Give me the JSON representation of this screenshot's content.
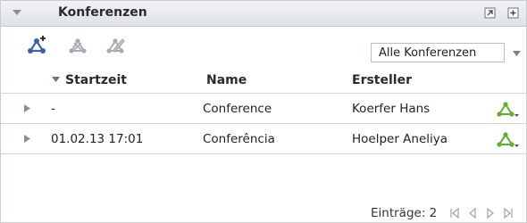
{
  "panel": {
    "title": "Konferenzen",
    "icons": [
      "expand-icon",
      "plus-box-icon",
      "collapse-arrow-icon"
    ]
  },
  "toolbar": {
    "icons": [
      "add-conference-icon",
      "remove-conference-icon",
      "edit-conference-icon"
    ],
    "filter_value": "Alle Konferenzen"
  },
  "table": {
    "columns": [
      "Startzeit",
      "Name",
      "Ersteller"
    ],
    "sort_column": "Startzeit",
    "rows": [
      {
        "start": "-",
        "name": "Conference",
        "creator": "Koerfer Hans"
      },
      {
        "start": "01.02.13 17:01",
        "name": "Conferência",
        "creator": "Hoelper Aneliya"
      }
    ]
  },
  "footer": {
    "entries_label": "Einträge: 2",
    "pager_icons": [
      "first-page-icon",
      "prev-page-icon",
      "next-page-icon",
      "last-page-icon"
    ]
  },
  "colors": {
    "accent_green": "#58b22a",
    "icon_blue": "#3a63ad",
    "disabled_gray": "#a9adb3"
  }
}
